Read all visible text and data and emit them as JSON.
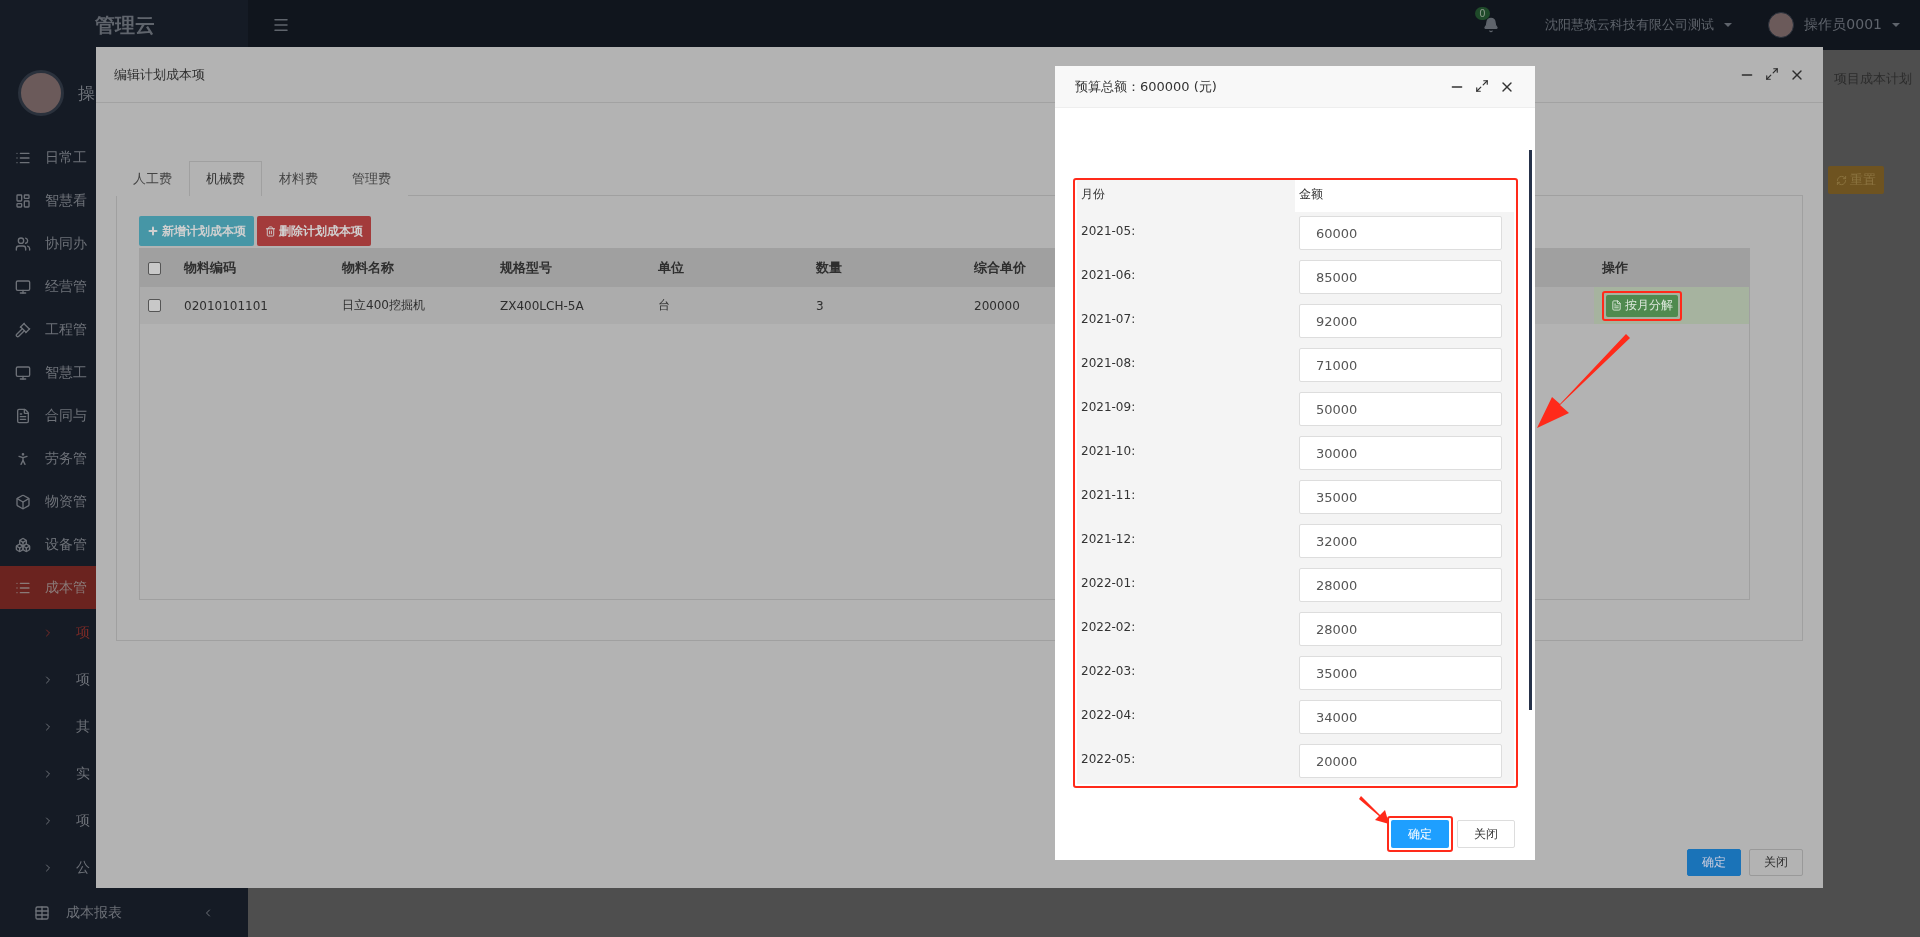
{
  "topbar": {
    "logo": "管理云",
    "notifications": "0",
    "company": "沈阳慧筑云科技有限公司测试",
    "user": "操作员0001"
  },
  "sidebar": {
    "user_name": "操",
    "items": [
      {
        "label": "日常工",
        "selected": false
      },
      {
        "label": "智慧看",
        "selected": false
      },
      {
        "label": "协同办",
        "selected": false
      },
      {
        "label": "经营管",
        "selected": false
      },
      {
        "label": "工程管",
        "selected": false
      },
      {
        "label": "智慧工",
        "selected": false
      },
      {
        "label": "合同与",
        "selected": false
      },
      {
        "label": "劳务管",
        "selected": false
      },
      {
        "label": "物资管",
        "selected": false
      },
      {
        "label": "设备管",
        "selected": false
      },
      {
        "label": "成本管",
        "selected": true,
        "children": [
          {
            "label": "项",
            "selected": true
          },
          {
            "label": "项",
            "selected": false
          },
          {
            "label": "其",
            "selected": false
          },
          {
            "label": "实",
            "selected": false
          },
          {
            "label": "项",
            "selected": false
          },
          {
            "label": "公",
            "selected": false
          }
        ]
      },
      {
        "label": "成本报表",
        "selected": false
      }
    ]
  },
  "page": {
    "breadcrumb": "项目成本计划",
    "reset_button": "重置"
  },
  "edit_dialog": {
    "title": "编辑计划成本项",
    "tabs": [
      {
        "label": "人工费",
        "selected": false
      },
      {
        "label": "机械费",
        "selected": true
      },
      {
        "label": "材料费",
        "selected": false
      },
      {
        "label": "管理费",
        "selected": false
      }
    ],
    "add_button": "新增计划成本项",
    "delete_button": "删除计划成本项",
    "table": {
      "all_checked": false,
      "columns": [
        "物料编码",
        "物料名称",
        "规格型号",
        "单位",
        "数量",
        "综合单价"
      ],
      "action_column": "操作",
      "rows": [
        {
          "checked": false,
          "cells": [
            "02010101101",
            "日立400挖掘机",
            "ZX400LCH-5A",
            "台",
            "3",
            "200000"
          ],
          "action": "按月分解"
        }
      ]
    },
    "footer": [
      "确定",
      "关闭"
    ]
  },
  "budget_dialog": {
    "title": "预算总额：600000 (元)",
    "columns": [
      "月份",
      "金额"
    ],
    "rows": [
      {
        "month": "2021-05:",
        "amount": "60000"
      },
      {
        "month": "2021-06:",
        "amount": "85000"
      },
      {
        "month": "2021-07:",
        "amount": "92000"
      },
      {
        "month": "2021-08:",
        "amount": "71000"
      },
      {
        "month": "2021-09:",
        "amount": "50000"
      },
      {
        "month": "2021-10:",
        "amount": "30000"
      },
      {
        "month": "2021-11:",
        "amount": "35000"
      },
      {
        "month": "2021-12:",
        "amount": "32000"
      },
      {
        "month": "2022-01:",
        "amount": "28000"
      },
      {
        "month": "2022-02:",
        "amount": "28000"
      },
      {
        "month": "2022-03:",
        "amount": "35000"
      },
      {
        "month": "2022-04:",
        "amount": "34000"
      },
      {
        "month": "2022-05:",
        "amount": "20000"
      }
    ],
    "footer": [
      "确定",
      "关闭"
    ]
  }
}
